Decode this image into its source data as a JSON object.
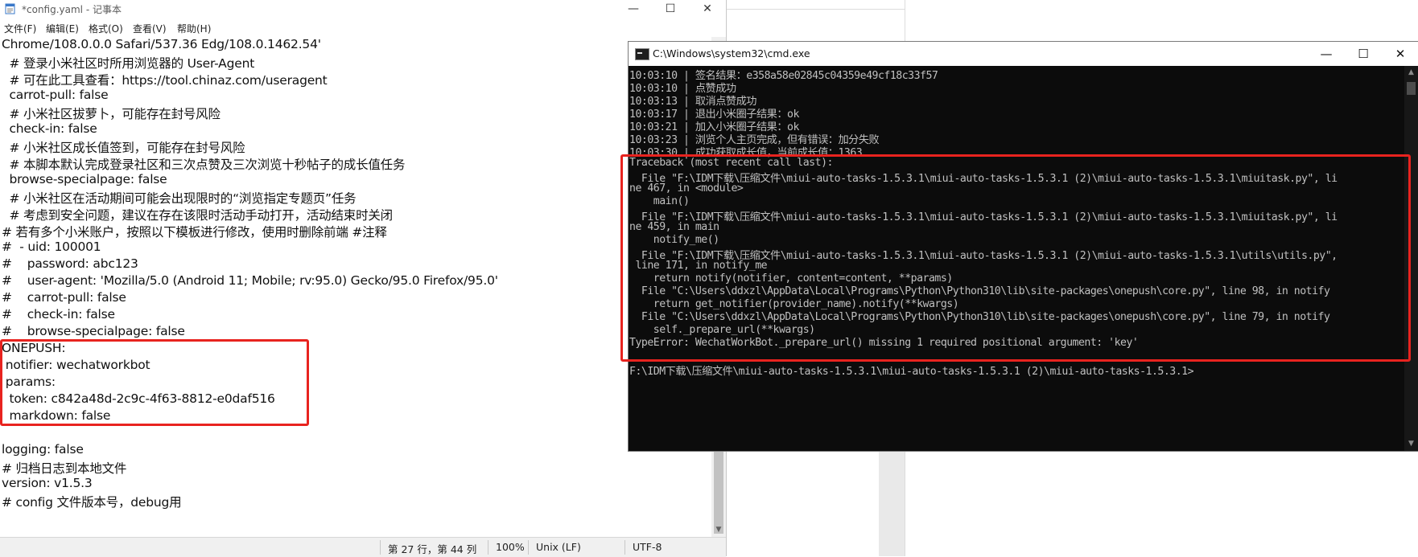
{
  "notepad": {
    "title": "*config.yaml - 记事本",
    "window_controls": {
      "minimize": "—",
      "maximize": "☐",
      "close": "✕"
    },
    "menu": [
      "文件(F)",
      "编辑(E)",
      "格式(O)",
      "查看(V)",
      "帮助(H)"
    ],
    "lines": [
      "Chrome/108.0.0.0 Safari/537.36 Edg/108.0.1462.54'",
      "  # 登录小米社区时所用浏览器的 User-Agent",
      "  # 可在此工具查看：https://tool.chinaz.com/useragent",
      "  carrot-pull: false",
      "  # 小米社区拔萝卜，可能存在封号风险",
      "  check-in: false",
      "  # 小米社区成长值签到，可能存在封号风险",
      "  # 本脚本默认完成登录社区和三次点赞及三次浏览十秒帖子的成长值任务",
      "  browse-specialpage: false",
      "  # 小米社区在活动期间可能会出现限时的“浏览指定专题页”任务",
      "  # 考虑到安全问题，建议在存在该限时活动手动打开，活动结束时关闭",
      "# 若有多个小米账户，按照以下模板进行修改，使用时删除前端 #注释",
      "#  - uid: 100001",
      "#    password: abc123",
      "#    user-agent: 'Mozilla/5.0 (Android 11; Mobile; rv:95.0) Gecko/95.0 Firefox/95.0'",
      "#    carrot-pull: false",
      "#    check-in: false",
      "#    browse-specialpage: false",
      "ONEPUSH:",
      " notifier: wechatworkbot",
      " params:",
      "  token: c842a48d-2c9c-4f63-8812-e0daf516",
      "  markdown: false",
      "",
      "logging: false",
      "# 归档日志到本地文件",
      "version: v1.5.3",
      "# config 文件版本号，debug用"
    ],
    "status": {
      "position": "第 27 行，第 44 列",
      "zoom": "100%",
      "eol": "Unix (LF)",
      "encoding": "UTF-8"
    }
  },
  "cmd": {
    "title": "C:\\Windows\\system32\\cmd.exe",
    "window_controls": {
      "minimize": "—",
      "maximize": "☐",
      "close": "✕"
    },
    "lines": [
      "10:03:10 | 签名结果：e358a58e02845c04359e49cf18c33f57",
      "10:03:10 | 点赞成功",
      "10:03:13 | 取消点赞成功",
      "10:03:17 | 退出小米圈子结果：ok",
      "10:03:21 | 加入小米圈子结果：ok",
      "10:03:23 | 浏览个人主页完成，但有错误：加分失败",
      "10:03:30 | 成功获取成长值，当前成长值：1363",
      "Traceback (most recent call last):",
      "  File \"F:\\IDM下载\\压缩文件\\miui-auto-tasks-1.5.3.1\\miui-auto-tasks-1.5.3.1 (2)\\miui-auto-tasks-1.5.3.1\\miuitask.py\", li",
      "ne 467, in <module>",
      "    main()",
      "  File \"F:\\IDM下载\\压缩文件\\miui-auto-tasks-1.5.3.1\\miui-auto-tasks-1.5.3.1 (2)\\miui-auto-tasks-1.5.3.1\\miuitask.py\", li",
      "ne 459, in main",
      "    notify_me()",
      "  File \"F:\\IDM下载\\压缩文件\\miui-auto-tasks-1.5.3.1\\miui-auto-tasks-1.5.3.1 (2)\\miui-auto-tasks-1.5.3.1\\utils\\utils.py\",",
      " line 171, in notify_me",
      "    return notify(notifier, content=content, **params)",
      "  File \"C:\\Users\\ddxzl\\AppData\\Local\\Programs\\Python\\Python310\\lib\\site-packages\\onepush\\core.py\", line 98, in notify",
      "    return get_notifier(provider_name).notify(**kwargs)",
      "  File \"C:\\Users\\ddxzl\\AppData\\Local\\Programs\\Python\\Python310\\lib\\site-packages\\onepush\\core.py\", line 79, in notify",
      "    self._prepare_url(**kwargs)",
      "TypeError: WechatWorkBot._prepare_url() missing 1 required positional argument: 'key'",
      "",
      "F:\\IDM下载\\压缩文件\\miui-auto-tasks-1.5.3.1\\miui-auto-tasks-1.5.3.1 (2)\\miui-auto-tasks-1.5.3.1>"
    ]
  },
  "highlight_color": "#e8231f"
}
